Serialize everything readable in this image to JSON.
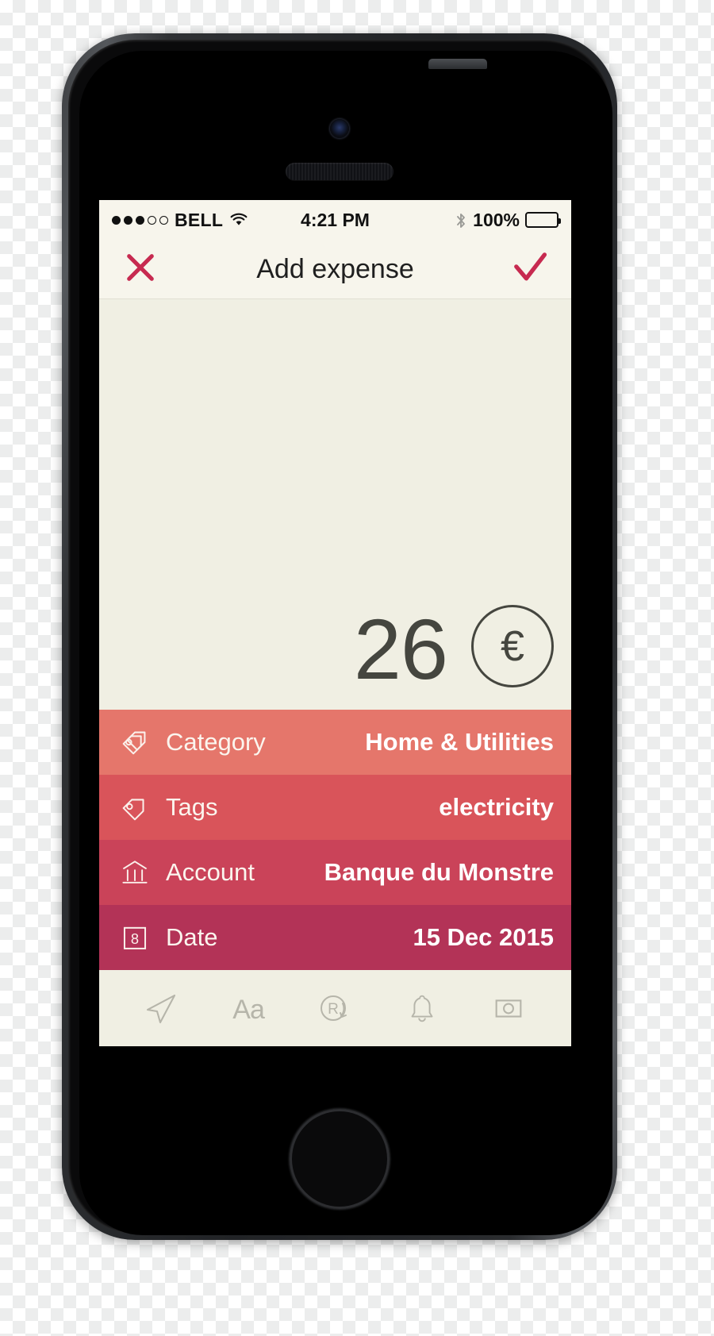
{
  "device": {
    "name": "iphone-5s-mockup",
    "camera_icon": "front-camera",
    "speaker_icon": "earpiece-speaker",
    "home_button_icon": "home-button"
  },
  "status_bar": {
    "signal_dots_filled": 3,
    "signal_dots_total": 5,
    "carrier": "BELL",
    "wifi_icon": "wifi-icon",
    "time": "4:21 PM",
    "bluetooth_icon": "bluetooth-icon",
    "battery_percent": "100%",
    "battery_icon": "battery-full-icon"
  },
  "nav_bar": {
    "close_icon": "close-x-icon",
    "title": "Add expense",
    "confirm_icon": "checkmark-icon",
    "accent_color": "#C72A50"
  },
  "amount": {
    "value": "26",
    "currency_symbol": "€",
    "text_color": "#45463F"
  },
  "fields": [
    {
      "name": "category",
      "icon": "double-tag-icon",
      "label": "Category",
      "value": "Home & Utilities",
      "bg_color": "#E5766B"
    },
    {
      "name": "tags",
      "icon": "tag-icon",
      "label": "Tags",
      "value": "electricity",
      "bg_color": "#D9545A"
    },
    {
      "name": "account",
      "icon": "bank-icon",
      "label": "Account",
      "value": "Banque du Monstre",
      "bg_color": "#CA4359"
    },
    {
      "name": "date",
      "icon": "calendar-icon",
      "label": "Date",
      "value": "15 Dec 2015",
      "bg_color": "#B33357"
    }
  ],
  "toolbar": {
    "icon_color": "#B6B5AA",
    "items": [
      {
        "name": "location",
        "icon": "location-arrow-icon",
        "label": ""
      },
      {
        "name": "note",
        "icon": "text-format-icon",
        "label": "Aa"
      },
      {
        "name": "recurrence",
        "icon": "repeat-r-icon",
        "label": "R"
      },
      {
        "name": "reminder",
        "icon": "bell-icon",
        "label": ""
      },
      {
        "name": "photo",
        "icon": "camera-icon",
        "label": ""
      }
    ]
  }
}
